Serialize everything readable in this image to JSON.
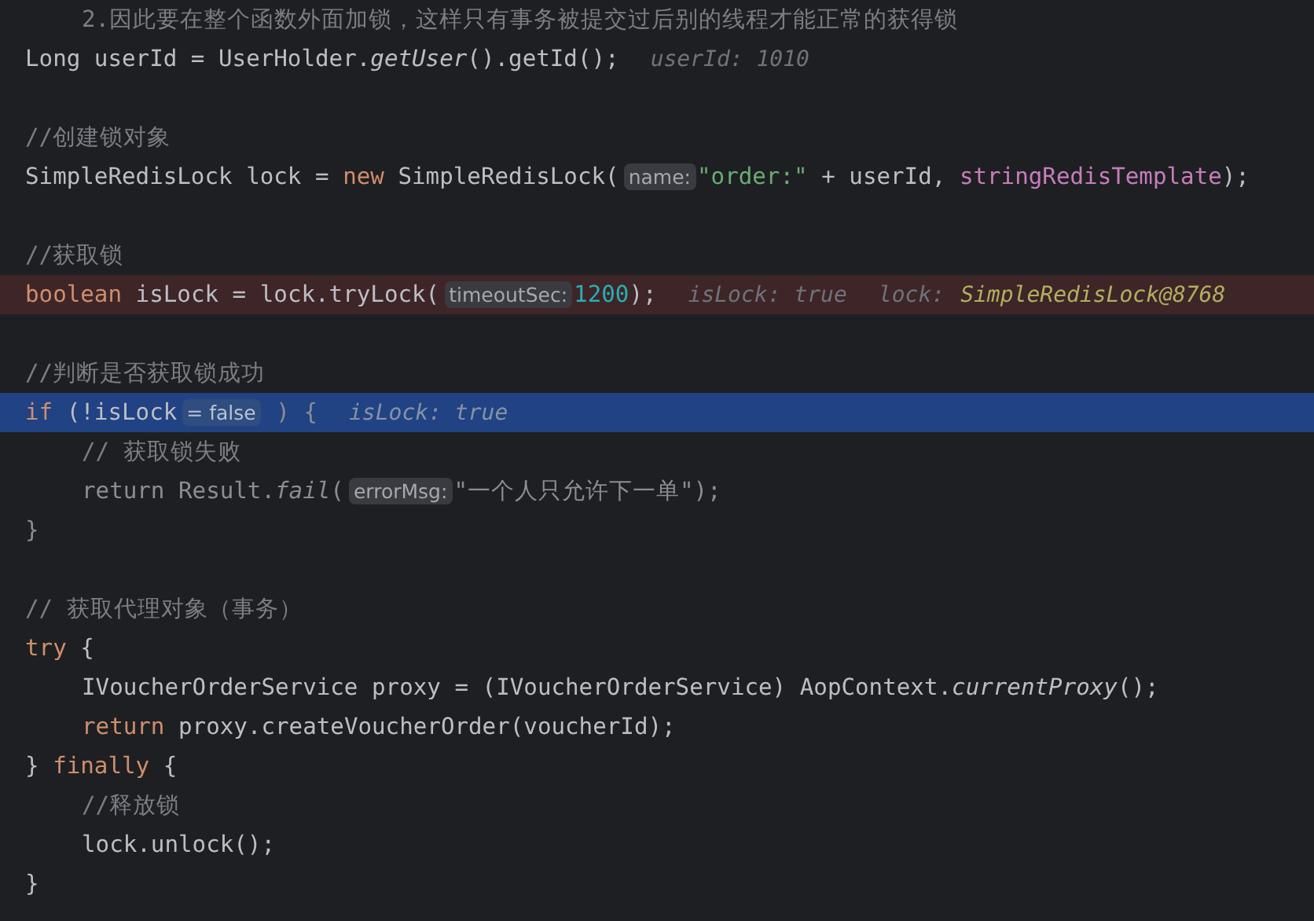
{
  "editor": {
    "lines": [
      {
        "kind": "doc-comment",
        "tokens": [
          {
            "text": "2.因此要在整个函数外面加锁，这样只有事务被提交过后别的线程才能正常的获得锁",
            "kind": "comment"
          }
        ]
      },
      {
        "kind": "code",
        "tokens": [
          {
            "text": "Long userId = UserHolder.",
            "kind": "plain"
          },
          {
            "text": "getUser",
            "kind": "italic"
          },
          {
            "text": "().getId();",
            "kind": "plain"
          },
          {
            "text": "userId: 1010",
            "kind": "debug"
          }
        ]
      },
      {
        "kind": "blank"
      },
      {
        "kind": "code",
        "tokens": [
          {
            "text": "//创建锁对象",
            "kind": "comment"
          }
        ]
      },
      {
        "kind": "code",
        "tokens": [
          {
            "text": "SimpleRedisLock lock = ",
            "kind": "plain"
          },
          {
            "text": "new",
            "kind": "keyword"
          },
          {
            "text": " SimpleRedisLock(",
            "kind": "plain"
          },
          {
            "text": "name:",
            "kind": "hint"
          },
          {
            "text": "\"order:\"",
            "kind": "string"
          },
          {
            "text": " + userId, ",
            "kind": "plain"
          },
          {
            "text": "stringRedisTemplate",
            "kind": "field"
          },
          {
            "text": ");",
            "kind": "plain"
          }
        ]
      },
      {
        "kind": "blank"
      },
      {
        "kind": "code",
        "tokens": [
          {
            "text": "//获取锁",
            "kind": "comment"
          }
        ]
      },
      {
        "kind": "breakpoint-line",
        "tokens": [
          {
            "text": "boolean",
            "kind": "keyword"
          },
          {
            "text": " isLock = lock.tryLock(",
            "kind": "plain"
          },
          {
            "text": "timeoutSec:",
            "kind": "hint"
          },
          {
            "text": "1200",
            "kind": "number"
          },
          {
            "text": ");",
            "kind": "plain"
          },
          {
            "text": "isLock: true",
            "kind": "debug"
          },
          {
            "text": "lock:",
            "kind": "debug"
          },
          {
            "text": "SimpleRedisLock@8768",
            "kind": "debug-ref"
          }
        ]
      },
      {
        "kind": "blank"
      },
      {
        "kind": "code",
        "tokens": [
          {
            "text": "//判断是否获取锁成功",
            "kind": "comment"
          }
        ]
      },
      {
        "kind": "execution-line",
        "tokens": [
          {
            "text": "if",
            "kind": "keyword"
          },
          {
            "text": " (!isLock",
            "kind": "plain"
          },
          {
            "text": "= false",
            "kind": "hint"
          },
          {
            "text": " ) {",
            "kind": "dim"
          },
          {
            "text": "isLock: true",
            "kind": "debug"
          }
        ],
        "children": [
          {
            "kind": "code",
            "tokens": [
              {
                "text": "// 获取锁失败",
                "kind": "comment"
              }
            ]
          },
          {
            "kind": "code",
            "tokens": [
              {
                "text": "return Result.",
                "kind": "dim"
              },
              {
                "text": "fail",
                "kind": "dim-italic"
              },
              {
                "text": "(",
                "kind": "dim"
              },
              {
                "text": "errorMsg:",
                "kind": "hint"
              },
              {
                "text": "\"一个人只允许下一单\");",
                "kind": "dim"
              }
            ]
          }
        ]
      },
      {
        "kind": "code",
        "tokens": [
          {
            "text": "}",
            "kind": "dim"
          }
        ]
      },
      {
        "kind": "blank"
      },
      {
        "kind": "code",
        "tokens": [
          {
            "text": "// 获取代理对象（事务）",
            "kind": "comment"
          }
        ]
      },
      {
        "kind": "code",
        "tokens": [
          {
            "text": "try",
            "kind": "keyword"
          },
          {
            "text": " {",
            "kind": "plain"
          }
        ],
        "children": [
          {
            "kind": "code",
            "tokens": [
              {
                "text": "IVoucherOrderService proxy = (IVoucherOrderService) AopContext.",
                "kind": "plain"
              },
              {
                "text": "currentProxy",
                "kind": "italic"
              },
              {
                "text": "();",
                "kind": "plain"
              }
            ]
          },
          {
            "kind": "code",
            "tokens": [
              {
                "text": "return",
                "kind": "keyword"
              },
              {
                "text": " proxy.createVoucherOrder(voucherId);",
                "kind": "plain"
              }
            ]
          }
        ]
      },
      {
        "kind": "code",
        "tokens": [
          {
            "text": "} ",
            "kind": "plain"
          },
          {
            "text": "finally",
            "kind": "keyword"
          },
          {
            "text": " {",
            "kind": "plain"
          }
        ],
        "children": [
          {
            "kind": "code",
            "tokens": [
              {
                "text": "//释放锁",
                "kind": "comment"
              }
            ]
          },
          {
            "kind": "code",
            "tokens": [
              {
                "text": "lock.unlock();",
                "kind": "plain"
              }
            ]
          }
        ]
      },
      {
        "kind": "code",
        "tokens": [
          {
            "text": "}",
            "kind": "plain"
          }
        ]
      }
    ]
  }
}
